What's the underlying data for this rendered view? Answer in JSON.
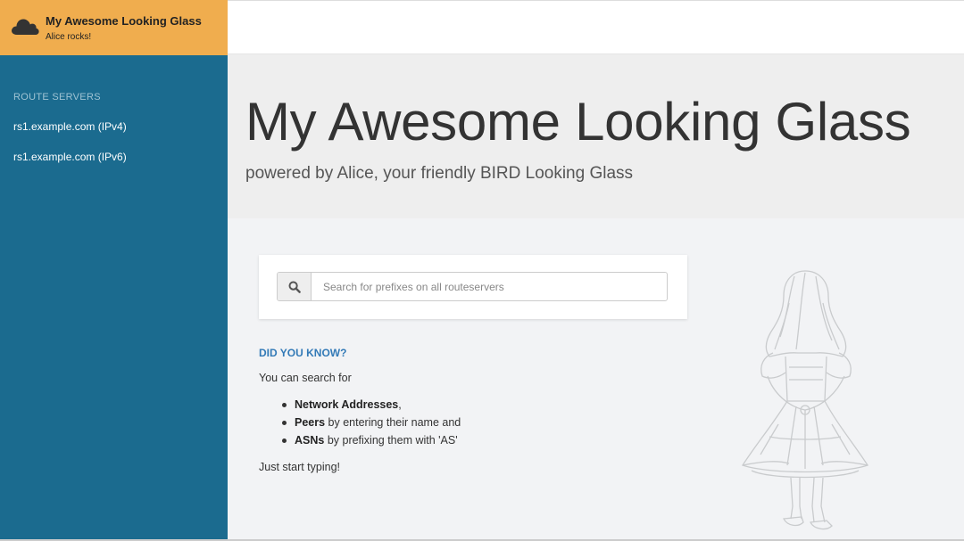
{
  "brand": {
    "title": "My Awesome Looking Glass",
    "subtitle": "Alice rocks!",
    "icon": "cloud-icon",
    "color": "#f0ad4e"
  },
  "sidebar": {
    "section_label": "ROUTE SERVERS",
    "items": [
      {
        "label": "rs1.example.com (IPv4)"
      },
      {
        "label": "rs1.example.com (IPv6)"
      }
    ],
    "color": "#1b6b8f"
  },
  "jumbotron": {
    "title": "My Awesome Looking Glass",
    "lead": "powered by Alice, your friendly BIRD Looking Glass"
  },
  "search": {
    "icon": "search-icon",
    "placeholder": "Search for prefixes on all routeservers",
    "value": ""
  },
  "did_you_know": {
    "title": "DID YOU KNOW?",
    "intro": "You can search for",
    "items": [
      {
        "bold": "Network Addresses",
        "rest": ","
      },
      {
        "bold": "Peers",
        "rest": " by entering their name and"
      },
      {
        "bold": "ASNs",
        "rest": " by prefixing them with 'AS'"
      }
    ],
    "outro": "Just start typing!",
    "accent": "#337ab7"
  },
  "illustration": "alice-illustration"
}
